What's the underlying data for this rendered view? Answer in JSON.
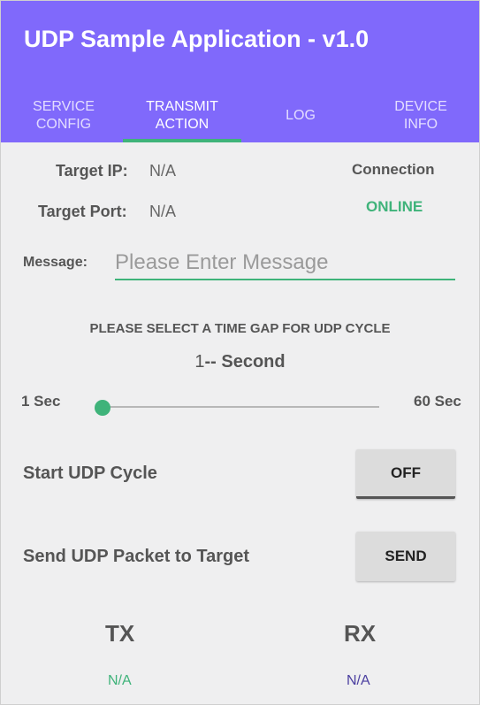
{
  "app": {
    "title": "UDP Sample Application - v1.0"
  },
  "tabs": [
    {
      "label": "SERVICE\nCONFIG",
      "selected": false
    },
    {
      "label": "TRANSMIT\nACTION",
      "selected": true
    },
    {
      "label": "LOG",
      "selected": false
    },
    {
      "label": "DEVICE\nINFO",
      "selected": false
    }
  ],
  "target": {
    "ip_label": "Target IP:",
    "ip_value": "N/A",
    "port_label": "Target Port:",
    "port_value": "N/A"
  },
  "connection": {
    "title": "Connection",
    "status": "ONLINE"
  },
  "message": {
    "label": "Message:",
    "value": "",
    "placeholder": "Please Enter Message"
  },
  "time_gap": {
    "title": "PLEASE SELECT A TIME GAP FOR UDP CYCLE",
    "value": "1",
    "unit": "-- Second",
    "min_label": "1 Sec",
    "max_label": "60 Sec",
    "slider_value": 1
  },
  "cycle": {
    "label": "Start UDP Cycle",
    "button": "OFF"
  },
  "send": {
    "label": "Send UDP Packet to Target",
    "button": "SEND"
  },
  "stats": {
    "tx_label": "TX",
    "tx_value": "N/A",
    "rx_label": "RX",
    "rx_value": "N/A"
  },
  "colors": {
    "accent": "#8069fb",
    "online": "#3fb37a",
    "rx": "#4b3fa0"
  }
}
